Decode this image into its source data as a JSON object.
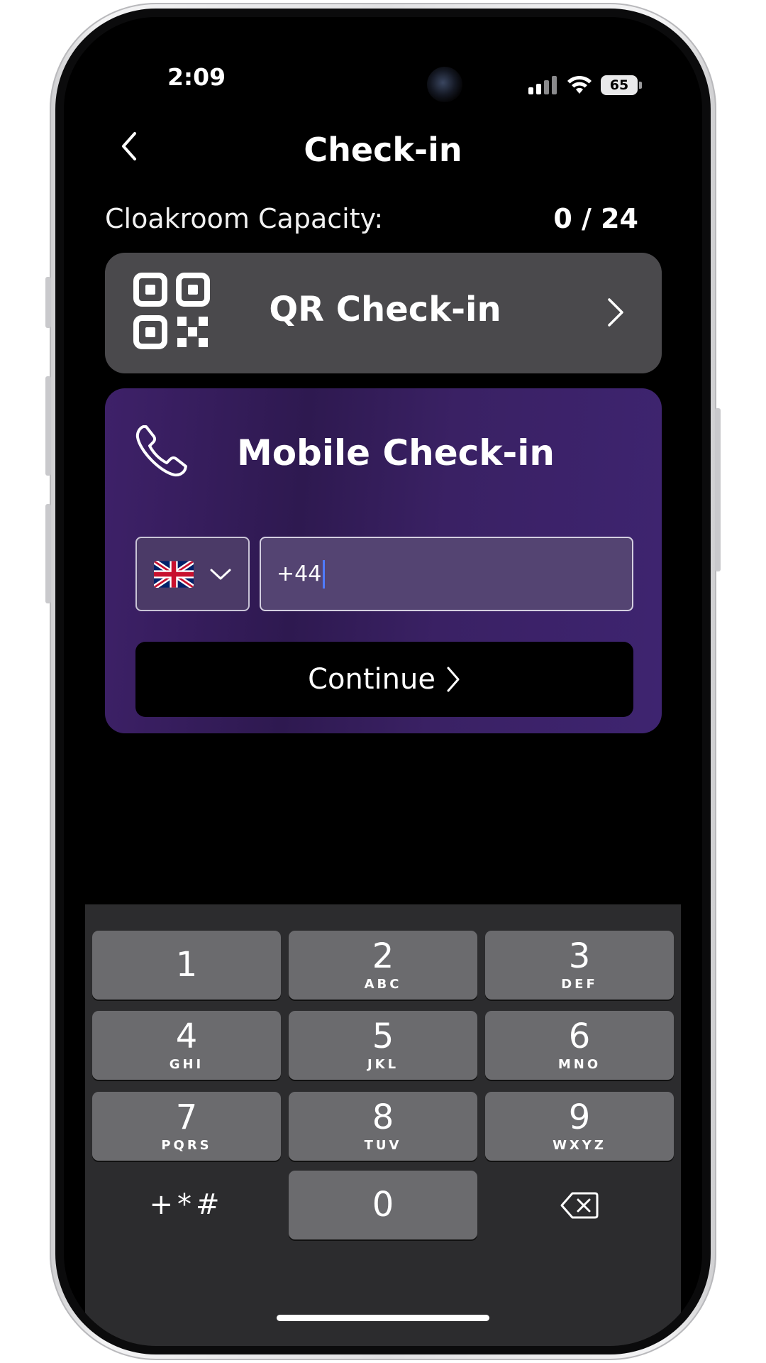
{
  "status_bar": {
    "time": "2:09",
    "battery": "65"
  },
  "header": {
    "title": "Check-in"
  },
  "capacity": {
    "label": "Cloakroom Capacity:",
    "value": "0 / 24"
  },
  "qr_card": {
    "label": "QR Check-in",
    "icon": "qr-code-icon"
  },
  "mobile_card": {
    "title": "Mobile Check-in",
    "icon": "phone-icon",
    "country": {
      "selected": "United Kingdom",
      "flag": "uk-flag-icon"
    },
    "phone_value": "+44",
    "continue_label": "Continue"
  },
  "keypad": {
    "keys": [
      {
        "digit": "1",
        "letters": ""
      },
      {
        "digit": "2",
        "letters": "ABC"
      },
      {
        "digit": "3",
        "letters": "DEF"
      },
      {
        "digit": "4",
        "letters": "GHI"
      },
      {
        "digit": "5",
        "letters": "JKL"
      },
      {
        "digit": "6",
        "letters": "MNO"
      },
      {
        "digit": "7",
        "letters": "PQRS"
      },
      {
        "digit": "8",
        "letters": "TUV"
      },
      {
        "digit": "9",
        "letters": "WXYZ"
      },
      {
        "digit": "0",
        "letters": ""
      }
    ],
    "symbols_label": "+*#"
  },
  "colors": {
    "accent": "#3e2169",
    "card_gray": "#4a494c",
    "caret": "#4f7bff"
  }
}
